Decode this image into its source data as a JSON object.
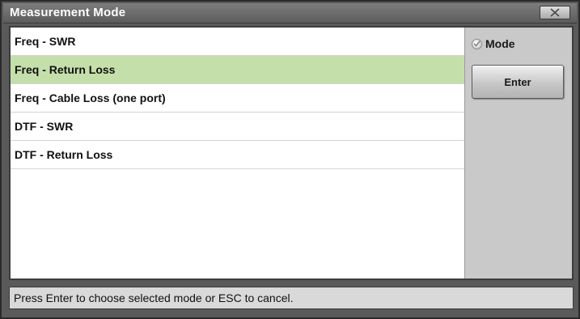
{
  "window": {
    "title": "Measurement Mode",
    "close_icon": "close-x-icon"
  },
  "list": {
    "selected_index": 1,
    "items": [
      {
        "label": "Freq - SWR"
      },
      {
        "label": "Freq - Return Loss"
      },
      {
        "label": "Freq - Cable Loss (one port)"
      },
      {
        "label": "DTF - SWR"
      },
      {
        "label": "DTF - Return Loss"
      }
    ]
  },
  "side": {
    "mode_label": "Mode",
    "enter_label": "Enter"
  },
  "status": {
    "message": "Press Enter to choose selected mode or ESC to cancel."
  },
  "colors": {
    "selection": "#c5dfaa",
    "titlebar": "#6a6a6a",
    "side_panel": "#c9c9c9"
  }
}
